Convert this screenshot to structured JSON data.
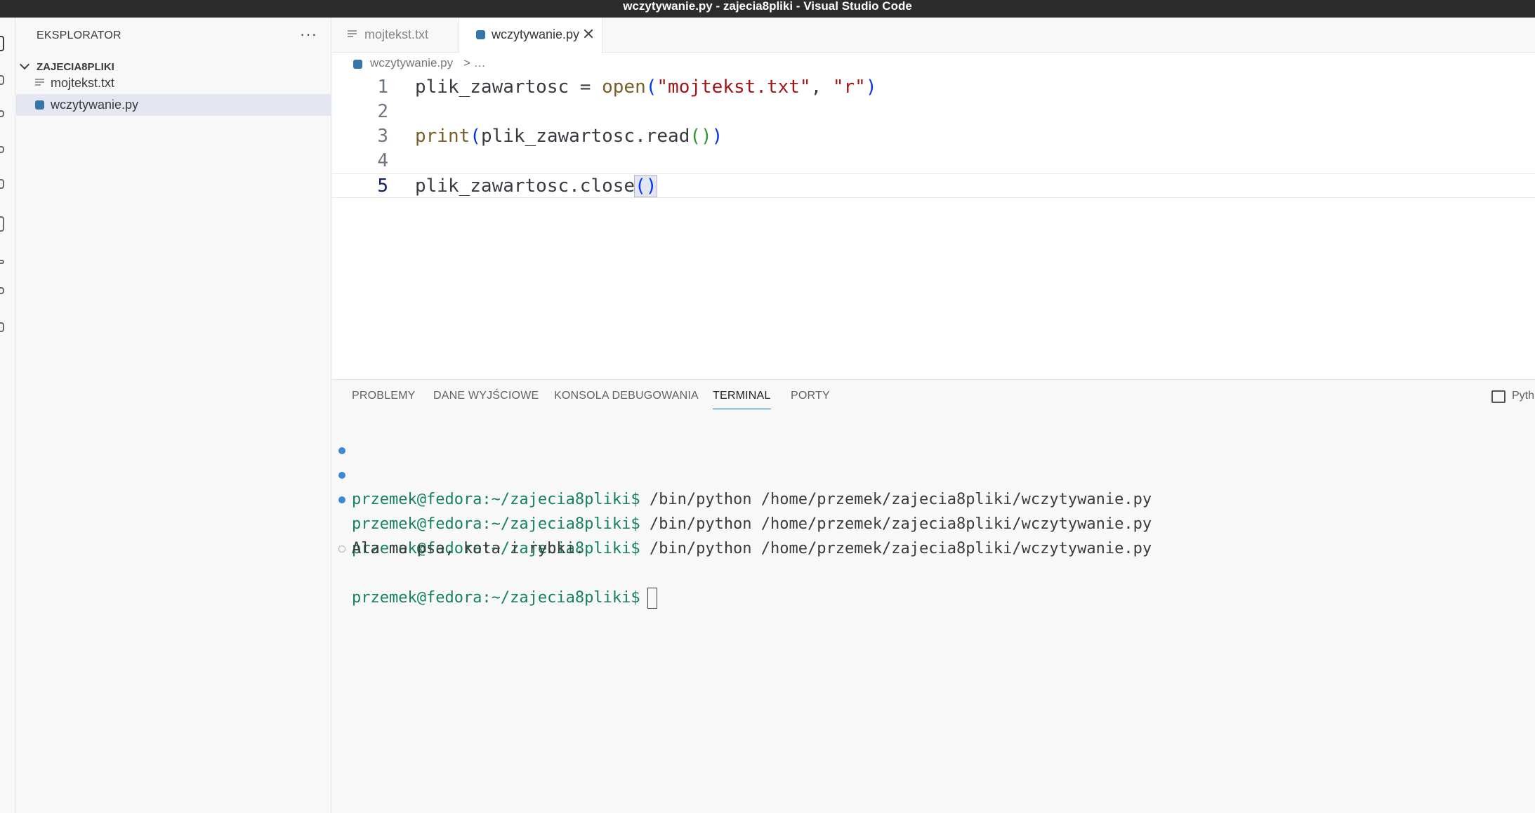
{
  "window": {
    "title": "wczytywanie.py - zajecia8pliki - Visual Studio Code"
  },
  "sidebar": {
    "header": "EKSPLORATOR",
    "more_label": "···",
    "folder": "ZAJECIA8PLIKI",
    "files": [
      {
        "label": "mojtekst.txt",
        "icon": "text-file-icon"
      },
      {
        "label": "wczytywanie.py",
        "icon": "python-file-icon",
        "selected": true
      }
    ]
  },
  "tabs": [
    {
      "label": "mojtekst.txt",
      "active": false
    },
    {
      "label": "wczytywanie.py",
      "active": true
    }
  ],
  "breadcrumb": {
    "file": "wczytywanie.py",
    "rest": "> …"
  },
  "editor": {
    "line_numbers": [
      "1",
      "2",
      "3",
      "4",
      "5"
    ],
    "current_line": "5",
    "code": {
      "l1_var": "plik_zawartosc",
      "l1_eq": " = ",
      "l1_fn": "open",
      "l1_open": "(",
      "l1_str1": "\"mojtekst.txt\"",
      "l1_comma": ", ",
      "l1_str2": "\"r\"",
      "l1_close": ")",
      "l3_fn": "print",
      "l3_open": "(",
      "l3_body": "plik_zawartosc.read",
      "l3_inner": "()",
      "l3_close": ")",
      "l5_body": "plik_zawartosc.close",
      "l5_parens": "()"
    }
  },
  "panel": {
    "tabs": [
      "PROBLEMY",
      "DANE WYJŚCIOWE",
      "KONSOLA DEBUGOWANIA",
      "TERMINAL",
      "PORTY"
    ],
    "active_tab": "TERMINAL",
    "terminal_label": "Pyth",
    "terminal": {
      "prompt": "przemek@fedora:~/zajecia8pliki$",
      "command": " /bin/python /home/przemek/zajecia8pliki/wczytywanie.py",
      "output": "Ala ma psa, kota i rybki."
    }
  },
  "colors": {
    "accent": "#005fb8",
    "prompt_green": "#16825d",
    "string_red": "#a31515",
    "function": "#795e26"
  }
}
